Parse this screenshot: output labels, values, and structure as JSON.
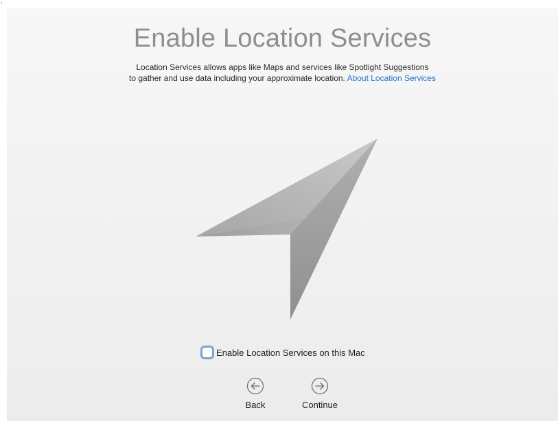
{
  "title": "Enable Location Services",
  "description": {
    "line1": "Location Services allows apps like Maps and services like Spotlight Suggestions",
    "line2": "to gather and use data including your approximate location.",
    "link": "About Location Services"
  },
  "checkbox": {
    "label": "Enable Location Services on this Mac",
    "checked": false
  },
  "nav": {
    "back_label": "Back",
    "continue_label": "Continue"
  },
  "colors": {
    "link": "#2b73c8",
    "title": "#8e8e8e",
    "focus_ring": "#6fa7eb"
  },
  "icons": {
    "hero": "location-arrow-icon",
    "back": "arrow-left-circle-icon",
    "continue": "arrow-right-circle-icon"
  }
}
